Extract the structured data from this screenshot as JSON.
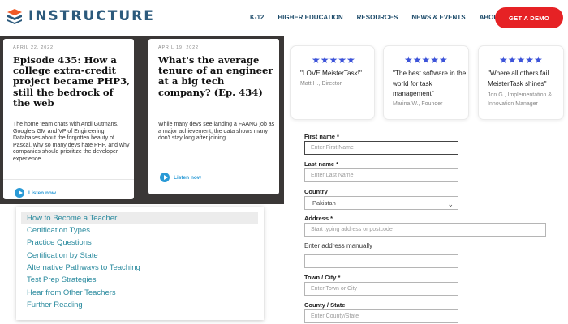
{
  "header": {
    "logo_text": "INSTRUCTURE",
    "nav_items": [
      "K-12",
      "HIGHER EDUCATION",
      "RESOURCES",
      "NEWS & EVENTS",
      "ABOUT US"
    ],
    "demo_button": "GET A DEMO",
    "brand_color": "#2c5a7c",
    "demo_color": "#e62225"
  },
  "podcasts": [
    {
      "date": "APRIL 22, 2022",
      "title": "Episode 435: How a college extra-credit project became PHP3, still the bedrock of the web",
      "description": "The home team chats with Andi Gutmans, Google's GM and VP of Engineering, Databases about the forgotten beauty of Pascal, why so many devs hate PHP, and why companies should prioritize the developer experience.",
      "listen": "Listen now"
    },
    {
      "date": "APRIL 19, 2022",
      "title": "What's the average tenure of an engineer at a big tech company? (Ep. 434)",
      "description": "While many devs see landing a FAANG job as a major achievement, the data shows many don't stay long after joining.",
      "listen": "Listen now"
    }
  ],
  "teacher_menu": {
    "items": [
      "How to Become a Teacher",
      "Certification Types",
      "Practice Questions",
      "Certification by State",
      "Alternative Pathways to Teaching",
      "Test Prep Strategies",
      "Hear from Other Teachers",
      "Further Reading"
    ],
    "active_index": 0,
    "link_color": "#2a8a9e"
  },
  "reviews": [
    {
      "stars": "★★★★★",
      "quote": "\"LOVE MeisterTask!\"",
      "author": "Matt H., Director"
    },
    {
      "stars": "★★★★★",
      "quote": "\"The best software in the world for task management\"",
      "author": "Marina W., Founder"
    },
    {
      "stars": "★★★★★",
      "quote": "\"Where all others fail MeisterTask shines\"",
      "author": "Jon G., Implementation & Innovation Manager"
    }
  ],
  "form": {
    "first_name": {
      "label": "First name *",
      "placeholder": "Enter First Name"
    },
    "last_name": {
      "label": "Last name *",
      "placeholder": "Enter Last Name"
    },
    "country": {
      "label": "Country",
      "value": "Pakistan"
    },
    "address": {
      "label": "Address *",
      "placeholder": "Start typing address or postcode",
      "manual_link": "Enter address manually"
    },
    "town": {
      "label": "Town / City *",
      "placeholder": "Enter Town or City"
    },
    "county": {
      "label": "County / State",
      "placeholder": "Enter County/State"
    }
  }
}
